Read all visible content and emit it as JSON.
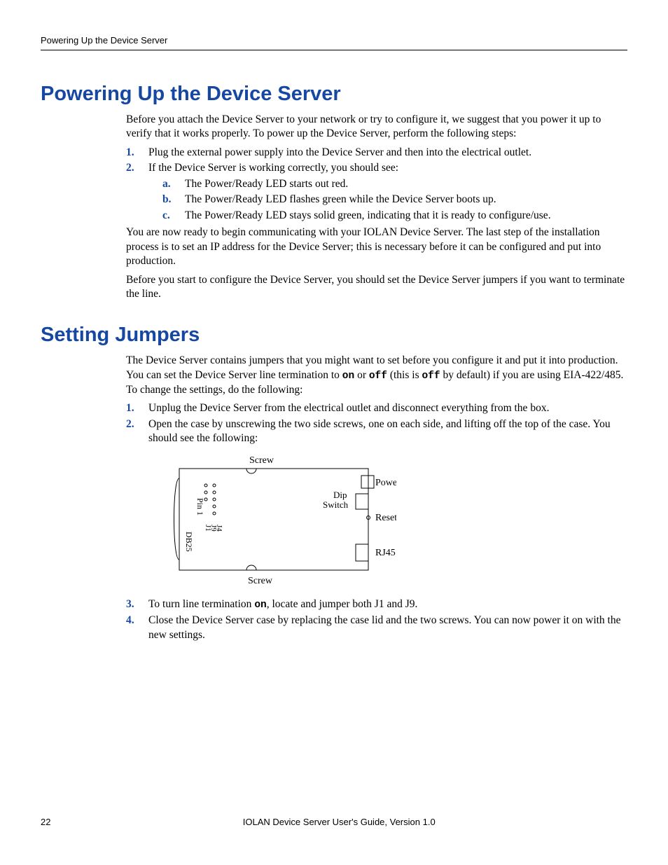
{
  "running_head": "Powering Up the Device Server",
  "section1": {
    "heading": "Powering Up the Device Server",
    "intro": "Before you attach the Device Server to your network or try to configure it, we suggest that you power it up to verify that it works properly. To power up the Device Server, perform the following steps:",
    "step1": "Plug the external power supply into the Device Server and then into the electrical outlet.",
    "step2": "If the Device Server is working correctly, you should see:",
    "sub_a": "The Power/Ready LED starts out red.",
    "sub_b": "The Power/Ready LED flashes green while the Device Server boots up.",
    "sub_c": "The Power/Ready LED stays solid green, indicating that it is ready to configure/use.",
    "para2": "You are now ready to begin communicating with your IOLAN Device Server. The last step of the installation process is to set an IP address for the Device Server; this is necessary before it can be configured and put into production.",
    "para3": "Before you start to configure the Device Server, you should set the Device Server jumpers if you want to terminate the line."
  },
  "section2": {
    "heading": "Setting Jumpers",
    "intro_pre": "The Device Server contains jumpers that you might want to set before you configure it and put it into production. You can set the Device Server line termination to ",
    "on": "on",
    "intro_mid": " or ",
    "off": "off",
    "intro_mid2": " (this is ",
    "off2": "off",
    "intro_post": " by default) if you are using EIA-422/485. To change the settings, do the following:",
    "step1": "Unplug the Device Server from the electrical outlet and disconnect everything from the box.",
    "step2": "Open the case by unscrewing the two side screws, one on each side, and lifting off the top of the case. You should see the following:",
    "step3_pre": "To turn line termination ",
    "step3_on": "on",
    "step3_post": ", locate and jumper both J1 and J9.",
    "step4": "Close the Device Server case by replacing the case lid and the two screws. You can now power it on with the new settings."
  },
  "diagram": {
    "screw_top": "Screw",
    "screw_bottom": "Screw",
    "db25": "DB25",
    "pin1": "Pin 1",
    "j1": "J1",
    "j9": "J9",
    "j4": "J4",
    "dip": "Dip",
    "switch": "Switch",
    "power": "Power",
    "reset": "Reset",
    "rj45": "RJ45"
  },
  "markers": {
    "m1": "1.",
    "m2": "2.",
    "m3": "3.",
    "m4": "4.",
    "ma": "a.",
    "mb": "b.",
    "mc": "c."
  },
  "footer": {
    "page": "22",
    "text": "IOLAN Device Server User's Guide, Version 1.0"
  }
}
